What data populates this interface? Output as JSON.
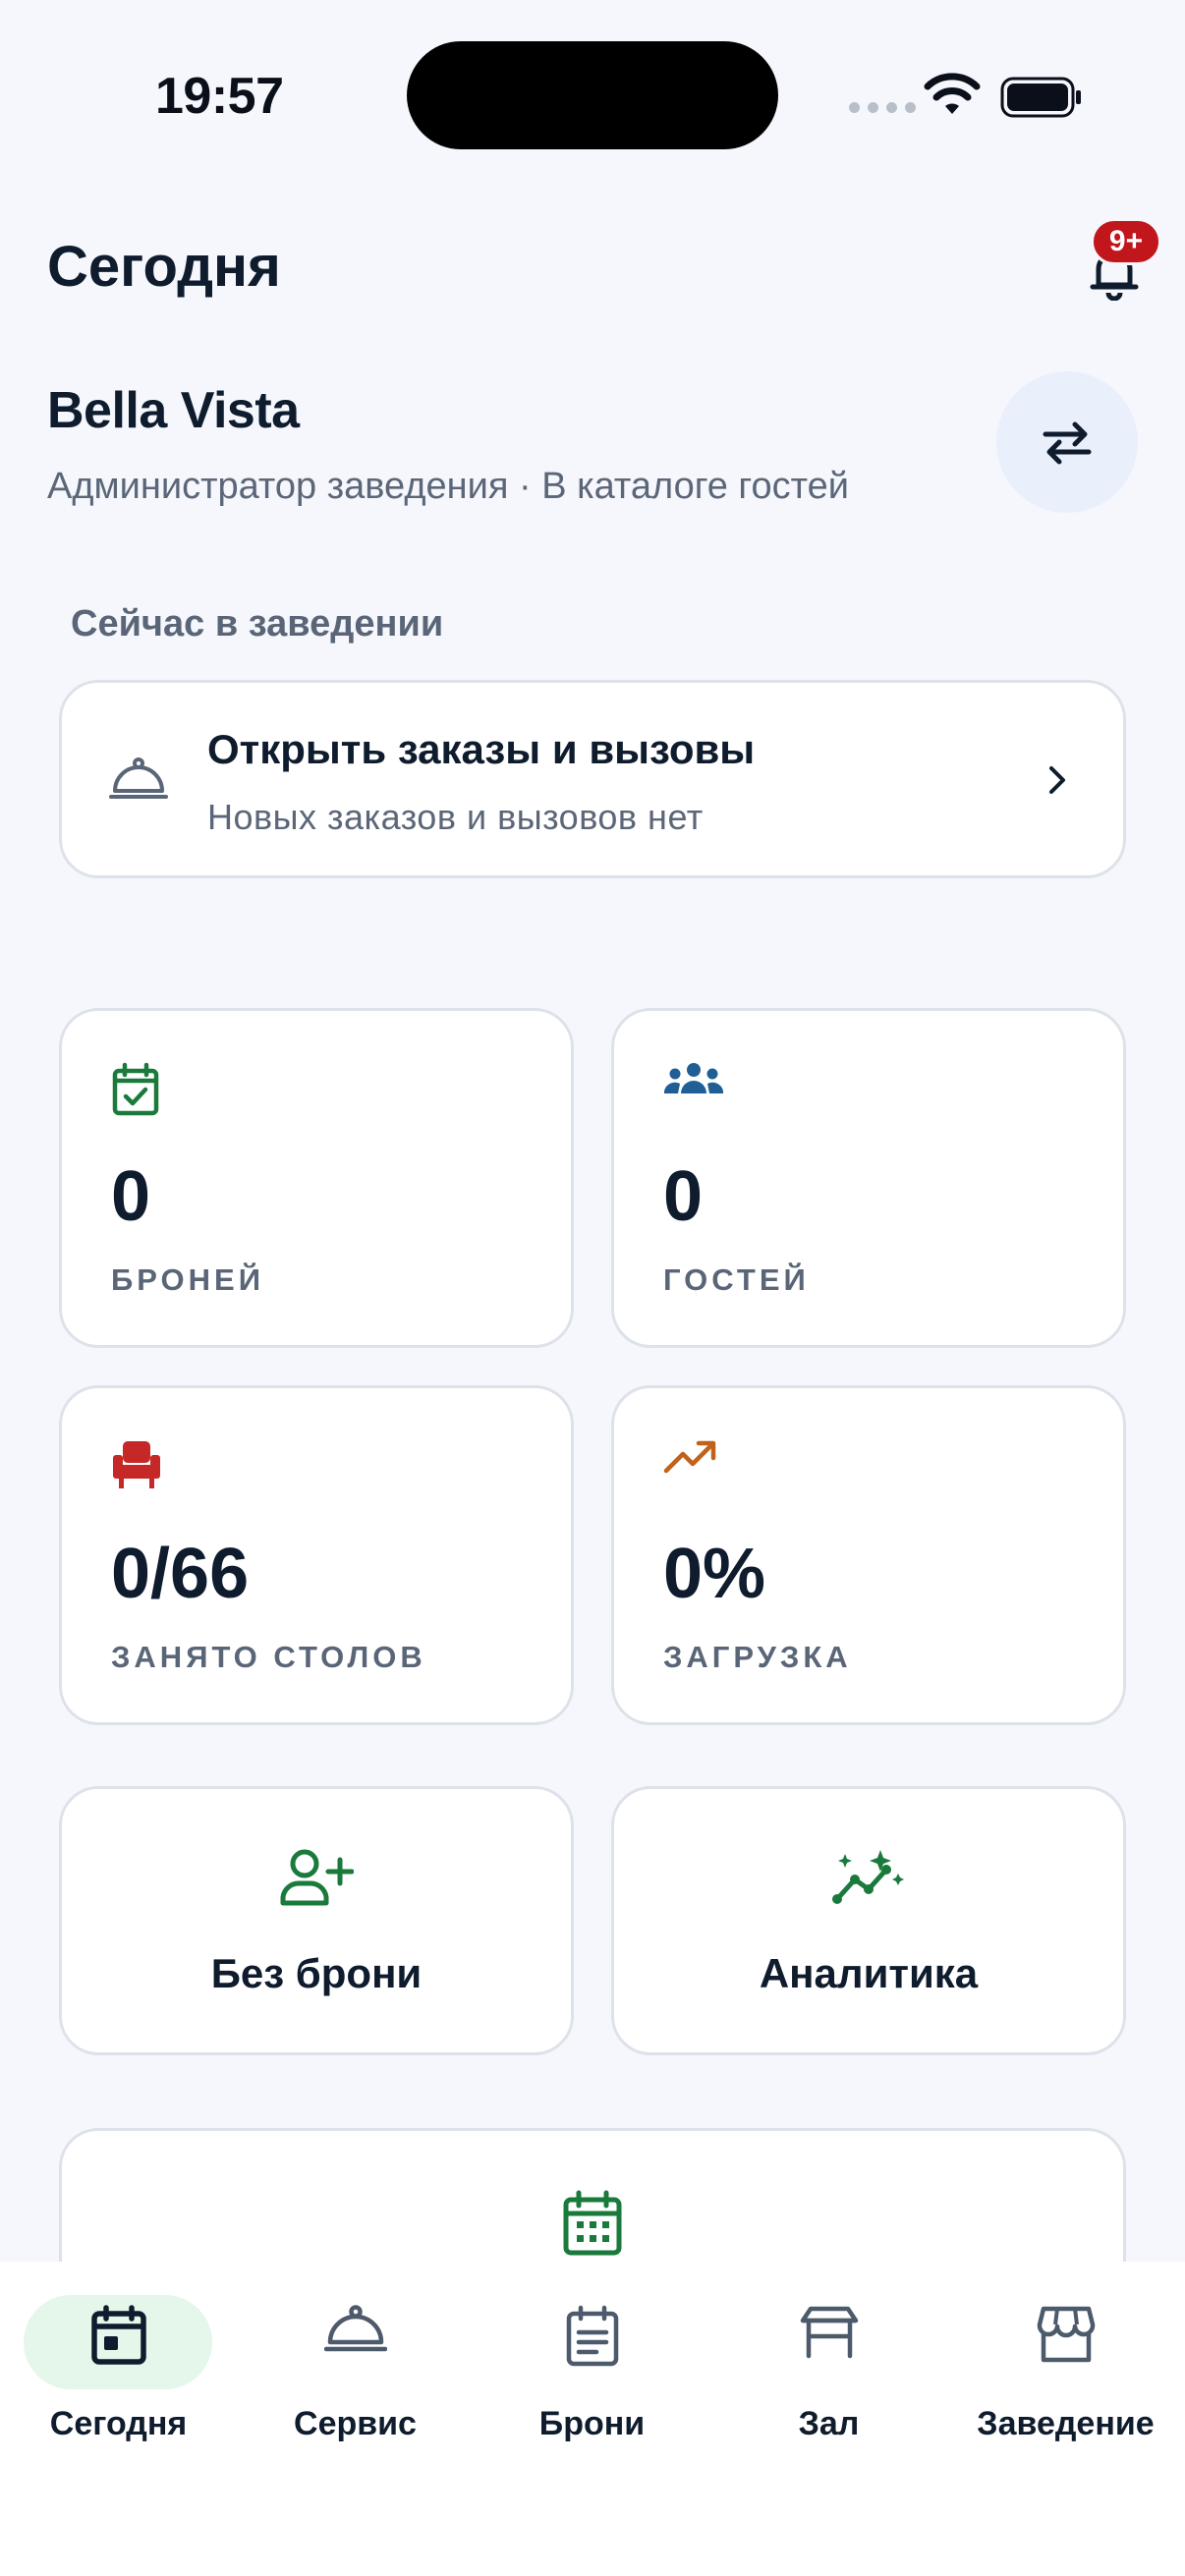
{
  "status_bar": {
    "time": "19:57"
  },
  "header": {
    "title": "Сегодня",
    "notifications_badge": "9+"
  },
  "venue": {
    "name": "Bella Vista",
    "subtitle": "Администратор заведения · В каталоге гостей"
  },
  "now_section": {
    "label": "Сейчас в заведении",
    "orders_card": {
      "title": "Открыть заказы и вызовы",
      "subtitle": "Новых заказов и вызовов нет"
    }
  },
  "stats": [
    {
      "icon": "calendar-check-icon",
      "value": "0",
      "label": "БРОНЕЙ",
      "color": "#1a7a3c"
    },
    {
      "icon": "people-group-icon",
      "value": "0",
      "label": "ГОСТЕЙ",
      "color": "#1f5f96"
    },
    {
      "icon": "armchair-icon",
      "value": "0/66",
      "label": "ЗАНЯТО СТОЛОВ",
      "color": "#c62828"
    },
    {
      "icon": "trending-up-icon",
      "value": "0%",
      "label": "ЗАГРУЗКА",
      "color": "#c0621a"
    }
  ],
  "actions": [
    {
      "icon": "add-person-icon",
      "label": "Без брони"
    },
    {
      "icon": "analytics-sparkle-icon",
      "label": "Аналитика"
    }
  ],
  "bottom_nav": {
    "items": [
      {
        "icon": "calendar-today-icon",
        "label": "Сегодня",
        "active": true
      },
      {
        "icon": "service-cloche-icon",
        "label": "Сервис",
        "active": false
      },
      {
        "icon": "bookings-list-icon",
        "label": "Брони",
        "active": false
      },
      {
        "icon": "hall-table-icon",
        "label": "Зал",
        "active": false
      },
      {
        "icon": "storefront-icon",
        "label": "Заведение",
        "active": false
      }
    ]
  },
  "colors": {
    "accent_green": "#1a7a3c",
    "active_pill": "#e4f7ea",
    "badge_red": "#c0161c",
    "text_primary": "#0f1c2e",
    "text_secondary": "#5b6678",
    "background": "#f5f7fc"
  }
}
